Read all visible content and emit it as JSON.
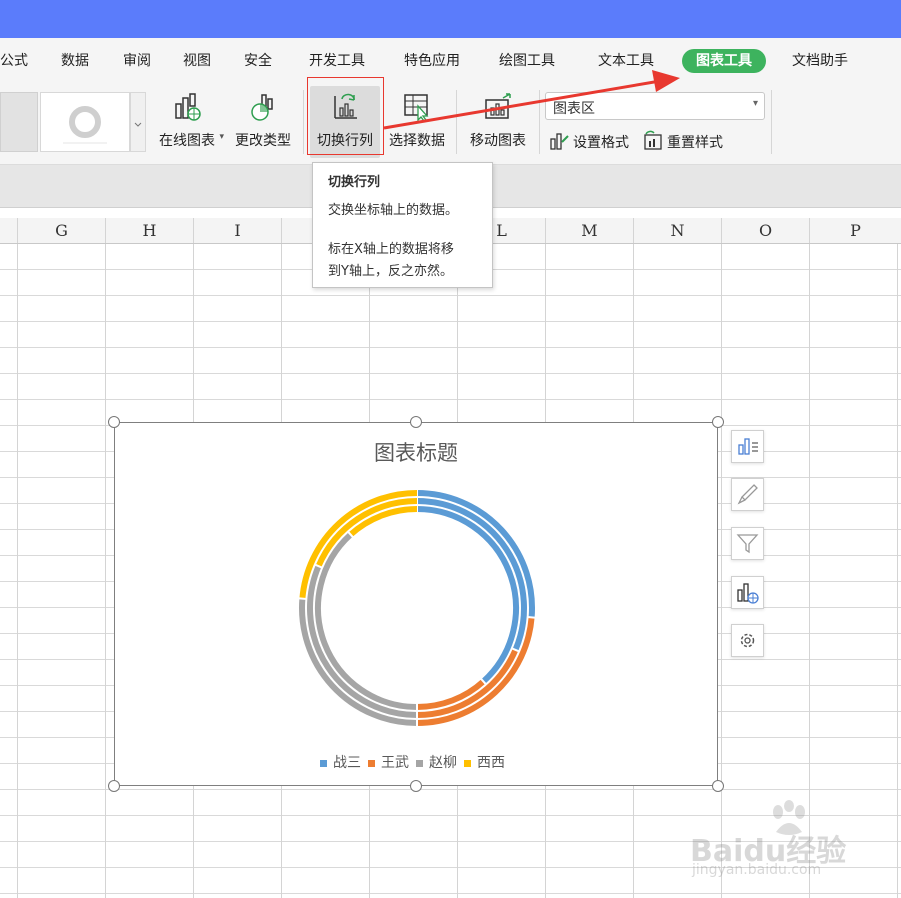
{
  "menu": {
    "tabs": [
      {
        "label": "公式"
      },
      {
        "label": "数据"
      },
      {
        "label": "审阅"
      },
      {
        "label": "视图"
      },
      {
        "label": "安全"
      },
      {
        "label": "开发工具"
      },
      {
        "label": "特色应用"
      },
      {
        "label": "绘图工具"
      },
      {
        "label": "文本工具"
      },
      {
        "label": "图表工具"
      },
      {
        "label": "文档助手"
      }
    ],
    "active_tab": "图表工具",
    "active_color": "#3db35e"
  },
  "ribbon": {
    "online_chart": "在线图表",
    "change_type": "更改类型",
    "switch_row_col": "切换行列",
    "select_data": "选择数据",
    "move_chart": "移动图表",
    "element_select_value": "图表区",
    "set_format": "设置格式",
    "reset_style": "重置样式"
  },
  "tooltip": {
    "title": "切换行列",
    "line1": "交换坐标轴上的数据。",
    "line2": "标在X轴上的数据将移",
    "line3": "到Y轴上，反之亦然。"
  },
  "columns": [
    "G",
    "H",
    "I",
    "",
    "",
    "L",
    "M",
    "N",
    "O",
    "P"
  ],
  "chart_data": {
    "type": "pie",
    "title": "图表标题",
    "legend": {
      "position": "bottom"
    },
    "series": [
      {
        "name": "战三",
        "color": "#5b9bd5"
      },
      {
        "name": "王武",
        "color": "#ed7d31"
      },
      {
        "name": "赵柳",
        "color": "#a5a5a5"
      },
      {
        "name": "西西",
        "color": "#ffc000"
      }
    ],
    "rings": [
      {
        "values": [
          0.263,
          0.237,
          0.263,
          0.237
        ]
      },
      {
        "values": [
          0.314,
          0.186,
          0.314,
          0.186
        ]
      },
      {
        "values": [
          0.383,
          0.117,
          0.383,
          0.117
        ]
      }
    ]
  },
  "chart_side_buttons": [
    {
      "icon": "chart-elements-icon"
    },
    {
      "icon": "chart-style-icon"
    },
    {
      "icon": "chart-filter-icon"
    },
    {
      "icon": "online-chart-icon"
    },
    {
      "icon": "settings-gear-icon"
    }
  ],
  "watermark": {
    "brand": "Baidu经验",
    "url": "jingyan.baidu.com"
  },
  "annotation_color": "#e8382f"
}
